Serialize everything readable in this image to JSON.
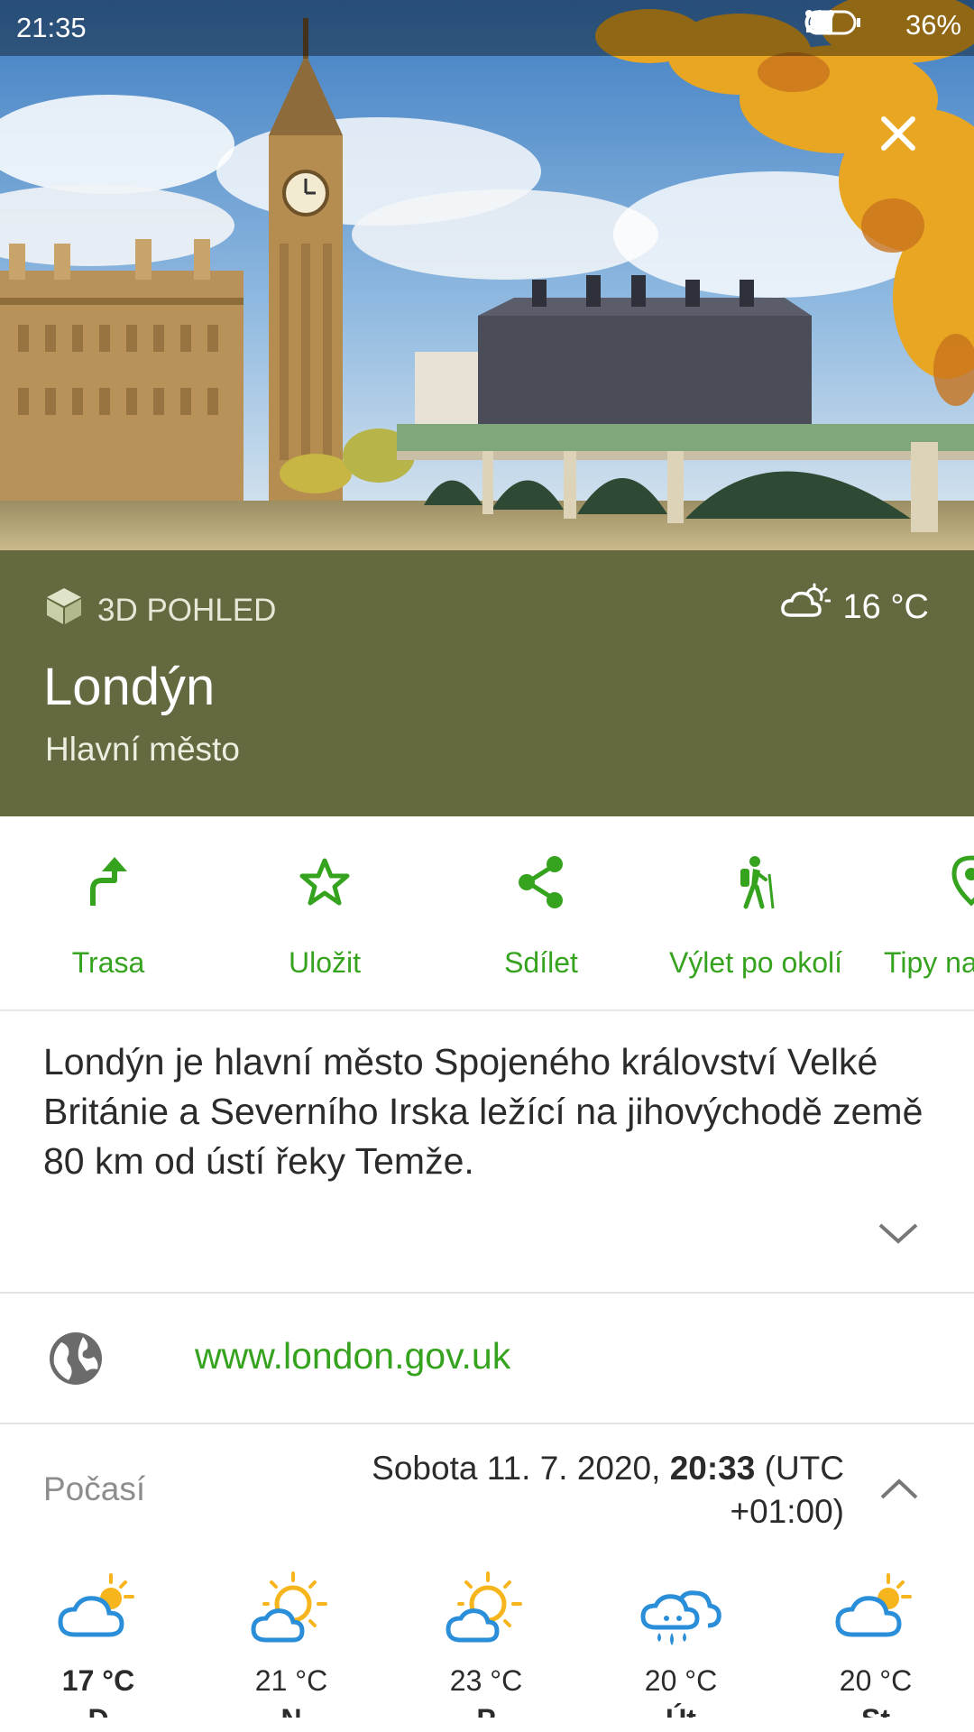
{
  "status_bar": {
    "time": "21:35",
    "battery": "36%"
  },
  "hero": {
    "close_icon": "close-icon"
  },
  "header": {
    "view_3d_label": "3D POHLED",
    "current_temp": "16 °C",
    "title": "Londýn",
    "subtitle": "Hlavní město"
  },
  "actions": [
    {
      "label": "Trasa",
      "icon": "route-icon"
    },
    {
      "label": "Uložit",
      "icon": "star-icon"
    },
    {
      "label": "Sdílet",
      "icon": "share-icon"
    },
    {
      "label": "Výlet po okolí",
      "icon": "hiker-icon"
    },
    {
      "label": "Tipy na",
      "icon": "tips-icon"
    }
  ],
  "description": "Londýn je hlavní město Spojeného království Velké Británie a Severního Irska ležící na jihovýchodě země 80 km od ústí řeky Temže.",
  "website": "www.london.gov.uk",
  "weather": {
    "label": "Počasí",
    "date_prefix": "Sobota 11. 7. 2020, ",
    "time": "20:33",
    "tz": " (UTC +01:00)",
    "forecast": [
      {
        "temp": "17 °C",
        "icon": "partly-cloudy-icon",
        "day": "D"
      },
      {
        "temp": "21 °C",
        "icon": "sun-cloud-icon",
        "day": "N"
      },
      {
        "temp": "23 °C",
        "icon": "sun-cloud-icon",
        "day": "P"
      },
      {
        "temp": "20 °C",
        "icon": "rain-icon",
        "day": "Út"
      },
      {
        "temp": "20 °C",
        "icon": "partly-cloudy-icon",
        "day": "St"
      }
    ]
  },
  "colors": {
    "accent": "#36a31f",
    "header_band": "#65693f",
    "weather_blue": "#2a8ed9",
    "sun_yellow": "#f6b51c"
  }
}
